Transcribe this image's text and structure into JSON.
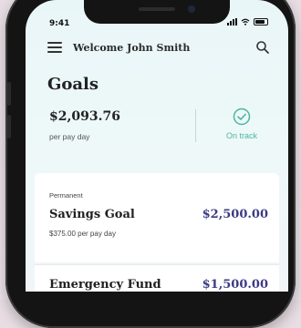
{
  "status_bar": {
    "time": "9:41"
  },
  "header": {
    "welcome": "Welcome John Smith"
  },
  "goals": {
    "title": "Goals",
    "amount": "$2,093.76",
    "amount_sub": "per pay day",
    "status": "On track"
  },
  "cards": [
    {
      "tag": "Permanent",
      "name": "Savings Goal",
      "value": "$2,500.00",
      "sub": "$375.00 per pay day"
    },
    {
      "name": "Emergency Fund",
      "value": "$1,500.00"
    }
  ],
  "colors": {
    "accent": "#3b3a84",
    "status_green": "#4db6a0"
  }
}
